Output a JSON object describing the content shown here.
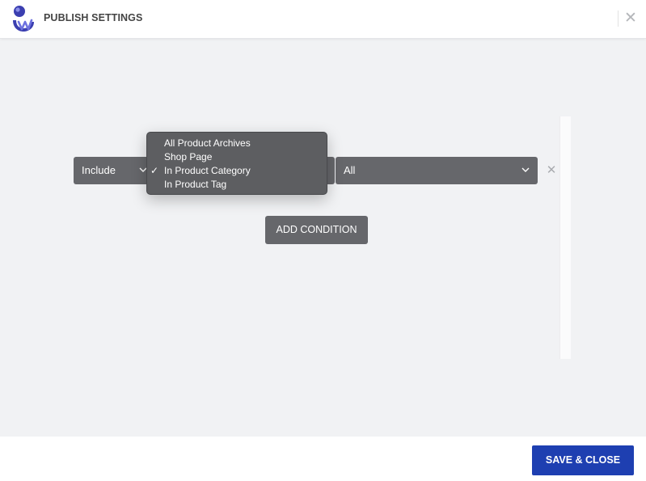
{
  "header": {
    "title": "PUBLISH SETTINGS",
    "close_glyph": "✕",
    "logo_icon": "brand-logo-icon",
    "close_icon": "close-icon"
  },
  "condition": {
    "mode_select": {
      "value": "Include",
      "icon": "chevron-down-icon"
    },
    "type_select": {
      "options": [
        "All Product Archives",
        "Shop Page",
        "In Product Category",
        "In Product Tag"
      ],
      "selected": "In Product Category",
      "check_glyph": "✓",
      "check_icon": "checkmark-icon"
    },
    "target_select": {
      "value": "All",
      "icon": "chevron-down-icon"
    },
    "remove_glyph": "✕",
    "remove_icon": "remove-icon"
  },
  "add_condition_label": "ADD CONDITION",
  "footer": {
    "save_label": "SAVE & CLOSE"
  },
  "colors": {
    "accent": "#1e3fb1",
    "control": "#66676b",
    "background": "#f1f2f4",
    "dropdown": "#5d5e61"
  }
}
